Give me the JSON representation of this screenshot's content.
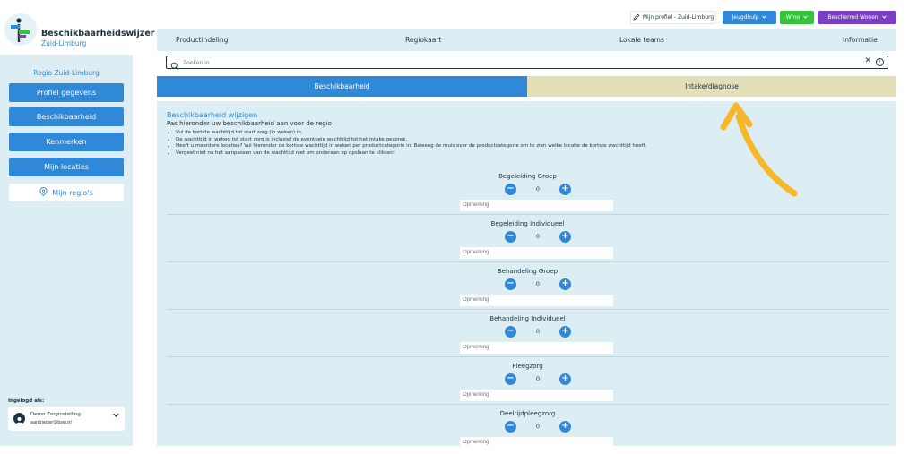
{
  "brand": {
    "title": "Beschikbaarheidswijzer",
    "subtitle": "Zuid-Limburg"
  },
  "sidebar": {
    "region_label": "Regio Zuid-Limburg",
    "buttons": [
      {
        "label": "Profiel gegevens"
      },
      {
        "label": "Beschikbaarheid"
      },
      {
        "label": "Kenmerken"
      },
      {
        "label": "Mijn locaties"
      }
    ],
    "regions_button": "Mijn regio's",
    "logged_in_label": "Ingelogd als:",
    "user": {
      "name": "Demo Zorginstelling",
      "email": "aanbieder@bsw.nl"
    }
  },
  "topbar": {
    "profile_button": "Mijn profiel - Zuid-Limburg",
    "domain_buttons": [
      {
        "label": "Jeugdhulp",
        "color": "#2f89d8"
      },
      {
        "label": "Wmo",
        "color": "#36c23b"
      },
      {
        "label": "Beschermd Wonen",
        "color": "#7b3fc6"
      }
    ]
  },
  "nav": {
    "items": [
      "Productindeling",
      "Regiokaart",
      "Lokale teams",
      "Informatie"
    ]
  },
  "search": {
    "placeholder": "Zoeken in"
  },
  "tabs": [
    {
      "label": "Beschikbaarheid",
      "active": true
    },
    {
      "label": "Intake/diagnose",
      "active": false
    }
  ],
  "content": {
    "title": "Beschikbaarheid wijzigen",
    "subtitle": "Pas hieronder uw beschikbaarheid aan voor de regio",
    "bullets": [
      "Vul de kortste wachttijd tot start zorg (in weken) in.",
      "De wachttijd in weken tot start zorg is inclusief de eventuele wachttijd tot het intake gesprek.",
      "Heeft u meerdere locaties? Vul hieronder de kortste wachttijd in weken per productcategorie in. Beweeg de muis over de productcategorie om te zien welke locatie de kortste wachttijd heeft.",
      "Vergeet niet na het aanpassen van de wachttijd niet om onderaan op opslaan te klikken!"
    ],
    "categories": [
      {
        "name": "Begeleiding Groep",
        "value": "0",
        "remark_placeholder": "Opmerking"
      },
      {
        "name": "Begeleiding Individueel",
        "value": "0",
        "remark_placeholder": "Opmerking"
      },
      {
        "name": "Behandeling Groep",
        "value": "0",
        "remark_placeholder": "Opmerking"
      },
      {
        "name": "Behandeling Individueel",
        "value": "0",
        "remark_placeholder": "Opmerking"
      },
      {
        "name": "Pleegzorg",
        "value": "0",
        "remark_placeholder": "Opmerking"
      },
      {
        "name": "Deeltijdpleegzorg",
        "value": "0",
        "remark_placeholder": "Opmerking"
      }
    ]
  },
  "colors": {
    "accent": "#2f89d8",
    "panel": "#dceef3",
    "tab_inactive": "#e3dfb9",
    "arrow": "#f5b82b"
  }
}
